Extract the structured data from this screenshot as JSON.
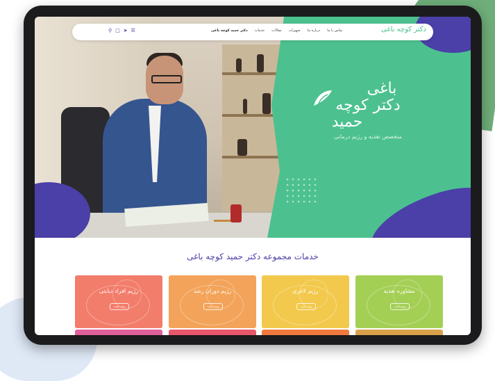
{
  "navbar": {
    "logo_text": "دکتر کوچه باغی",
    "links": [
      "دکتر حمید کوچه باغی",
      "خدمات",
      "مقالات",
      "تجهیزات",
      "درباره ما",
      "تماس با ما"
    ],
    "icons": [
      "search-icon",
      "instagram-icon",
      "telegram-icon",
      "menu-icon"
    ]
  },
  "hero": {
    "logo_line1": "دکتر کوچه",
    "logo_line2": "باغی",
    "logo_line3": "حمید",
    "logo_subtitle": "متخصص تغذیه و رژیم درمانی"
  },
  "services": {
    "title": "خدمات مجموعه دکتر حمید کوچه باغی",
    "cards": [
      {
        "label": "رژیم افراد دیابتی",
        "button": "بیشتر بخوانید",
        "color": "#f27d6b"
      },
      {
        "label": "رژیم دوران رشد",
        "button": "بیشتر بخوانید",
        "color": "#f3a45a"
      },
      {
        "label": "رژیم لاغری",
        "button": "بیشتر بخوانید",
        "color": "#f2c94c"
      },
      {
        "label": "مشاوره تغذیه",
        "button": "بیشتر بخوانید",
        "color": "#a4cf55"
      }
    ],
    "second_row_colors": [
      "#e0609a",
      "#e9576b",
      "#f07a3e",
      "#d9a24a"
    ]
  },
  "colors": {
    "green": "#4cc18f",
    "purple": "#4b3fa8",
    "tablet_frame": "#1b1b1d"
  }
}
